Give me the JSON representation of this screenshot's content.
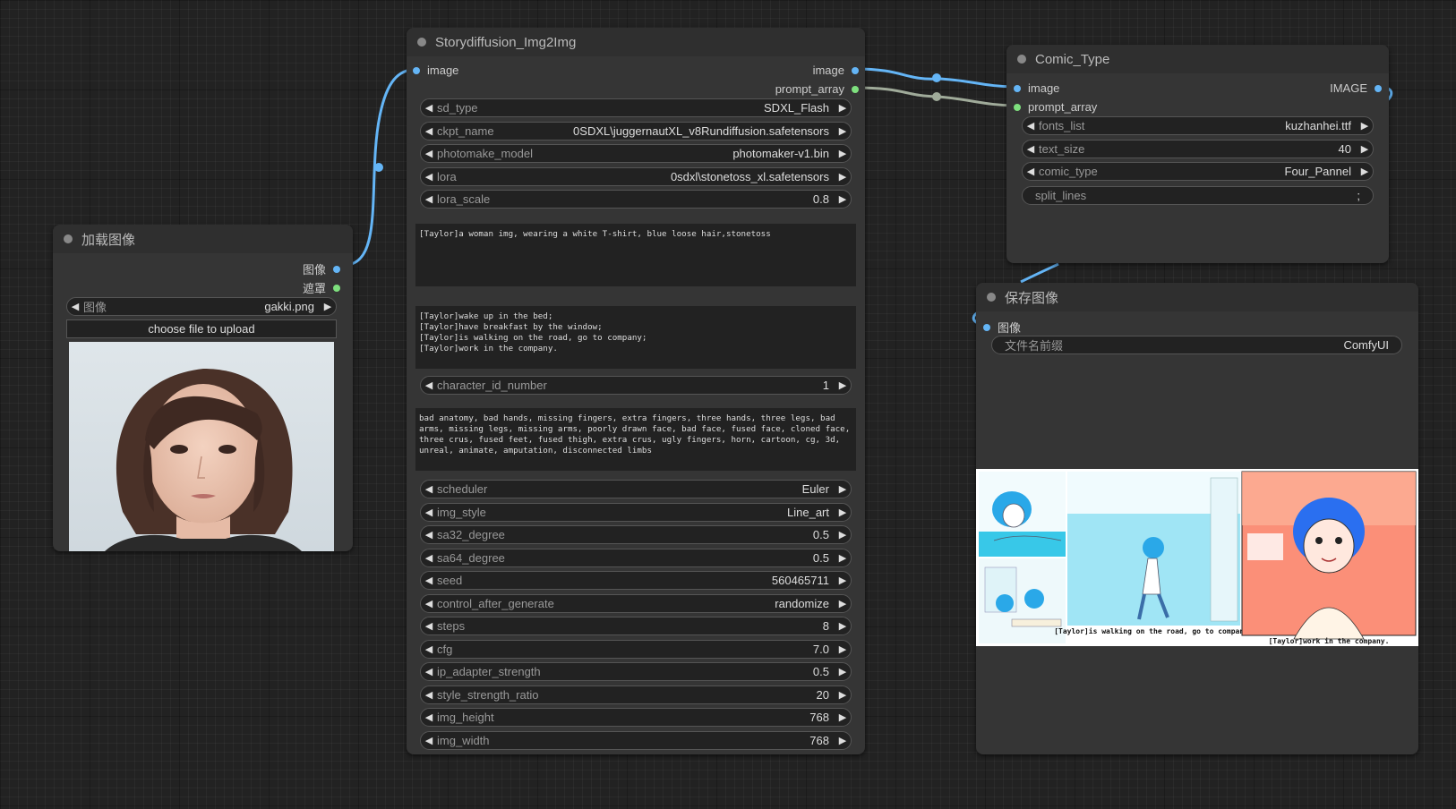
{
  "colors": {
    "wire_image": "#64b5f6",
    "wire_prompt": "#a0ab9a",
    "socket_image": "#64b5f6",
    "socket_prompt": "#7ee07e"
  },
  "load_image_node": {
    "title": "加载图像",
    "outputs": {
      "image": "图像",
      "mask": "遮罩"
    },
    "widget_image": {
      "label": "图像",
      "value": "gakki.png"
    },
    "upload_label": "choose file to upload",
    "preview": "portrait photo of a woman with short brown hair"
  },
  "story_node": {
    "title": "Storydiffusion_Img2Img",
    "inputs": {
      "image": "image"
    },
    "outputs": {
      "image": "image",
      "prompt_array": "prompt_array"
    },
    "widgets_top": [
      {
        "label": "sd_type",
        "value": "SDXL_Flash"
      },
      {
        "label": "ckpt_name",
        "value": "0SDXL\\juggernautXL_v8Rundiffusion.safetensors"
      },
      {
        "label": "photomake_model",
        "value": "photomaker-v1.bin"
      },
      {
        "label": "lora",
        "value": "0sdxl\\stonetoss_xl.safetensors"
      },
      {
        "label": "lora_scale",
        "value": "0.8"
      }
    ],
    "character_prompt": "[Taylor]a woman img, wearing a white T-shirt, blue loose hair,stonetoss",
    "scene_prompts": "[Taylor]wake up in the bed;\n[Taylor]have breakfast by the window;\n[Taylor]is walking on the road, go to company;\n[Taylor]work in the company.",
    "widget_character_id": {
      "label": "character_id_number",
      "value": "1"
    },
    "negative_prompt": "bad anatomy, bad hands, missing fingers, extra fingers, three hands, three legs, bad arms, missing legs, missing arms, poorly drawn face, bad face, fused face, cloned face, three crus, fused feet, fused thigh, extra crus, ugly fingers, horn, cartoon, cg, 3d, unreal, animate, amputation, disconnected limbs",
    "widgets_bottom": [
      {
        "label": "scheduler",
        "value": "Euler"
      },
      {
        "label": "img_style",
        "value": "Line_art"
      },
      {
        "label": "sa32_degree",
        "value": "0.5"
      },
      {
        "label": "sa64_degree",
        "value": "0.5"
      },
      {
        "label": "seed",
        "value": "560465711"
      },
      {
        "label": "control_after_generate",
        "value": "randomize"
      },
      {
        "label": "steps",
        "value": "8"
      },
      {
        "label": "cfg",
        "value": "7.0"
      },
      {
        "label": "ip_adapter_strength",
        "value": "0.5"
      },
      {
        "label": "style_strength_ratio",
        "value": "20"
      },
      {
        "label": "img_height",
        "value": "768"
      },
      {
        "label": "img_width",
        "value": "768"
      }
    ]
  },
  "comic_node": {
    "title": "Comic_Type",
    "inputs": {
      "image": "image",
      "prompt_array": "prompt_array"
    },
    "outputs": {
      "image": "IMAGE"
    },
    "widgets": [
      {
        "label": "fonts_list",
        "value": "kuzhanhei.ttf"
      },
      {
        "label": "text_size",
        "value": "40"
      },
      {
        "label": "comic_type",
        "value": "Four_Pannel"
      }
    ],
    "split_lines": {
      "label": "split_lines",
      "value": ";"
    }
  },
  "save_node": {
    "title": "保存图像",
    "inputs": {
      "image": "图像"
    },
    "widget_prefix": {
      "label": "文件名前缀",
      "value": "ComfyUI"
    },
    "preview_captions": {
      "walking": "[Taylor]is walking on the road, go to company;",
      "work": "[Taylor]work in the company."
    }
  }
}
